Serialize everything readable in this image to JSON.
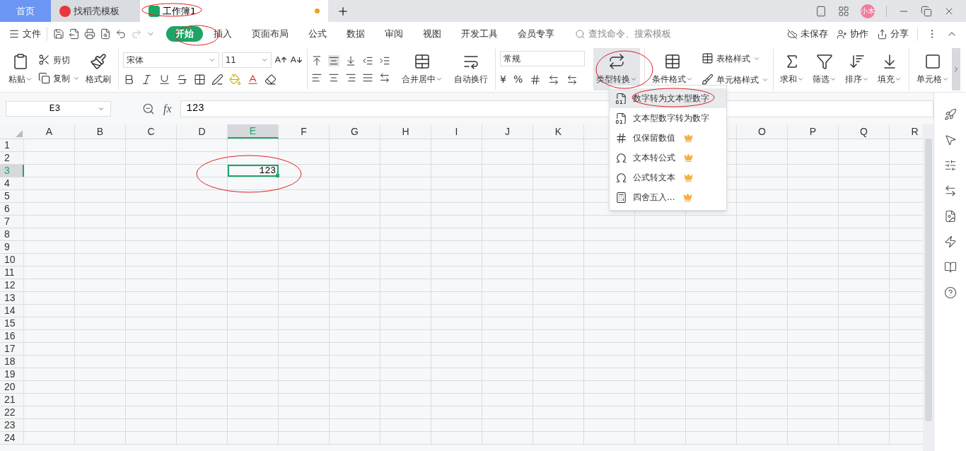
{
  "tabs": [
    {
      "label": "首页",
      "kind": "home",
      "selected": false,
      "unsaved": false
    },
    {
      "label": "找稻壳模板",
      "kind": "docer",
      "selected": false,
      "unsaved": false
    },
    {
      "label": "工作簿1",
      "kind": "sheet",
      "selected": true,
      "unsaved": true
    }
  ],
  "avatar": "小木",
  "menu": {
    "file": "文件",
    "tabs": [
      {
        "label": "开始",
        "selected": true
      },
      {
        "label": "插入",
        "selected": false
      },
      {
        "label": "页面布局",
        "selected": false
      },
      {
        "label": "公式",
        "selected": false
      },
      {
        "label": "数据",
        "selected": false
      },
      {
        "label": "审阅",
        "selected": false
      },
      {
        "label": "视图",
        "selected": false
      },
      {
        "label": "开发工具",
        "selected": false
      },
      {
        "label": "会员专享",
        "selected": false
      }
    ],
    "search": {
      "placeholder": "查找命令、搜索模板"
    },
    "actions": [
      "未保存",
      "协作",
      "分享"
    ]
  },
  "ribbon": {
    "paste": "粘贴",
    "cut": "剪切",
    "copy": "复制",
    "painter": "格式刷",
    "font": "宋体",
    "size": "11",
    "merge": "合并居中",
    "wrap": "自动换行",
    "number_format": "常规",
    "currency": "¥",
    "percent": "%",
    "convert": "类型转换",
    "convert_open": true,
    "conditional": "条件格式",
    "table_style": "表格样式",
    "cell_style": "单元格样式",
    "sum": "求和",
    "filter": "筛选",
    "sort": "排序",
    "fill": "填充",
    "cell": "单元格"
  },
  "convert_menu": [
    {
      "label": "数字转为文本型数字",
      "premium": false,
      "selected": true
    },
    {
      "label": "文本型数字转为数字",
      "premium": false,
      "selected": false
    },
    {
      "label": "仅保留数值",
      "premium": true,
      "selected": false
    },
    {
      "label": "文本转公式",
      "premium": true,
      "selected": false
    },
    {
      "label": "公式转文本",
      "premium": true,
      "selected": false
    },
    {
      "label": "四舍五入...",
      "premium": true,
      "selected": false
    }
  ],
  "formula_bar": {
    "cell_ref": "E3",
    "fx": "fx",
    "value": "123"
  },
  "sheet": {
    "columns": [
      {
        "label": "A",
        "selected": false
      },
      {
        "label": "B",
        "selected": false
      },
      {
        "label": "C",
        "selected": false
      },
      {
        "label": "D",
        "selected": false
      },
      {
        "label": "E",
        "selected": true
      },
      {
        "label": "F",
        "selected": false
      },
      {
        "label": "G",
        "selected": false
      },
      {
        "label": "H",
        "selected": false
      },
      {
        "label": "I",
        "selected": false
      },
      {
        "label": "J",
        "selected": false
      },
      {
        "label": "K",
        "selected": false
      },
      {},
      {},
      {},
      {
        "label": "O",
        "selected": false
      },
      {
        "label": "P",
        "selected": false
      },
      {
        "label": "Q",
        "selected": false
      },
      {
        "label": "R",
        "selected": false
      }
    ],
    "rows": [
      {
        "label": "1",
        "selected": false
      },
      {
        "label": "2",
        "selected": false
      },
      {
        "label": "3",
        "selected": true
      },
      {
        "label": "4",
        "selected": false
      },
      {
        "label": "5",
        "selected": false
      },
      {
        "label": "6",
        "selected": false
      },
      {
        "label": "7",
        "selected": false
      },
      {
        "label": "8",
        "selected": false
      },
      {
        "label": "9",
        "selected": false
      },
      {
        "label": "10",
        "selected": false
      },
      {
        "label": "11",
        "selected": false
      },
      {
        "label": "12",
        "selected": false
      },
      {
        "label": "13",
        "selected": false
      },
      {
        "label": "14",
        "selected": false
      },
      {
        "label": "15",
        "selected": false
      },
      {
        "label": "16",
        "selected": false
      },
      {
        "label": "17",
        "selected": false
      },
      {
        "label": "18",
        "selected": false
      },
      {
        "label": "19",
        "selected": false
      },
      {
        "label": "20",
        "selected": false
      },
      {
        "label": "21",
        "selected": false
      },
      {
        "label": "22",
        "selected": false
      },
      {
        "label": "23",
        "selected": false
      },
      {
        "label": "24",
        "selected": false
      }
    ],
    "active_cell": {
      "value": "123"
    }
  }
}
